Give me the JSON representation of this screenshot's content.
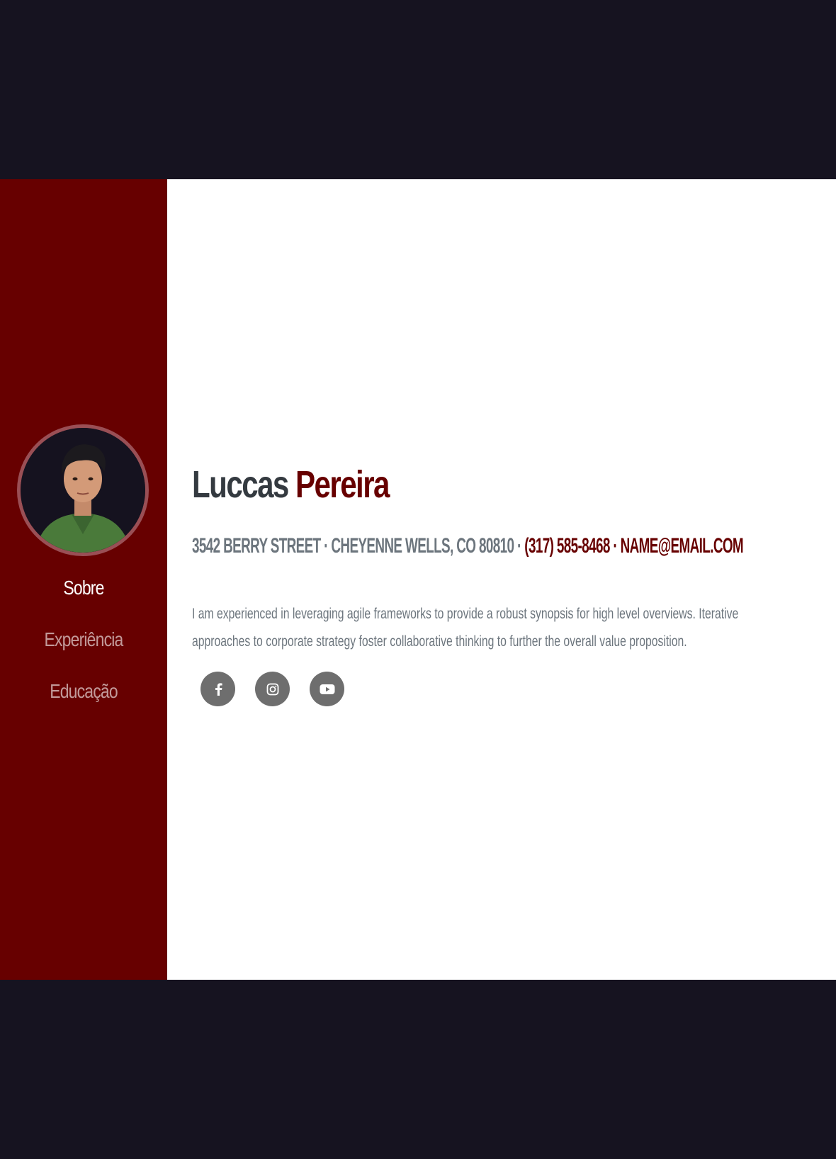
{
  "profile": {
    "first_name": "Luccas",
    "last_name": "Pereira",
    "address": "3542 BERRY STREET · CHEYENNE WELLS, CO 80810 ·",
    "phone": "(317) 585-8468",
    "separator": "·",
    "email": "NAME@EMAIL.COM",
    "bio": "I am experienced in leveraging agile frameworks to provide a robust synopsis for high level overviews. Iterative approaches to corporate strategy foster collaborative thinking to further the overall value proposition."
  },
  "nav": {
    "items": [
      {
        "label": "Sobre",
        "active": true
      },
      {
        "label": "Experiência",
        "active": false
      },
      {
        "label": "Educação",
        "active": false
      }
    ]
  },
  "social": {
    "icons": [
      "facebook-icon",
      "instagram-icon",
      "youtube-icon"
    ]
  },
  "colors": {
    "page_background": "#161320",
    "sidebar": "#670000",
    "accent": "#670000",
    "text_dark": "#343a40",
    "text_muted": "#6c757d",
    "social_button": "#6e6e6e"
  }
}
